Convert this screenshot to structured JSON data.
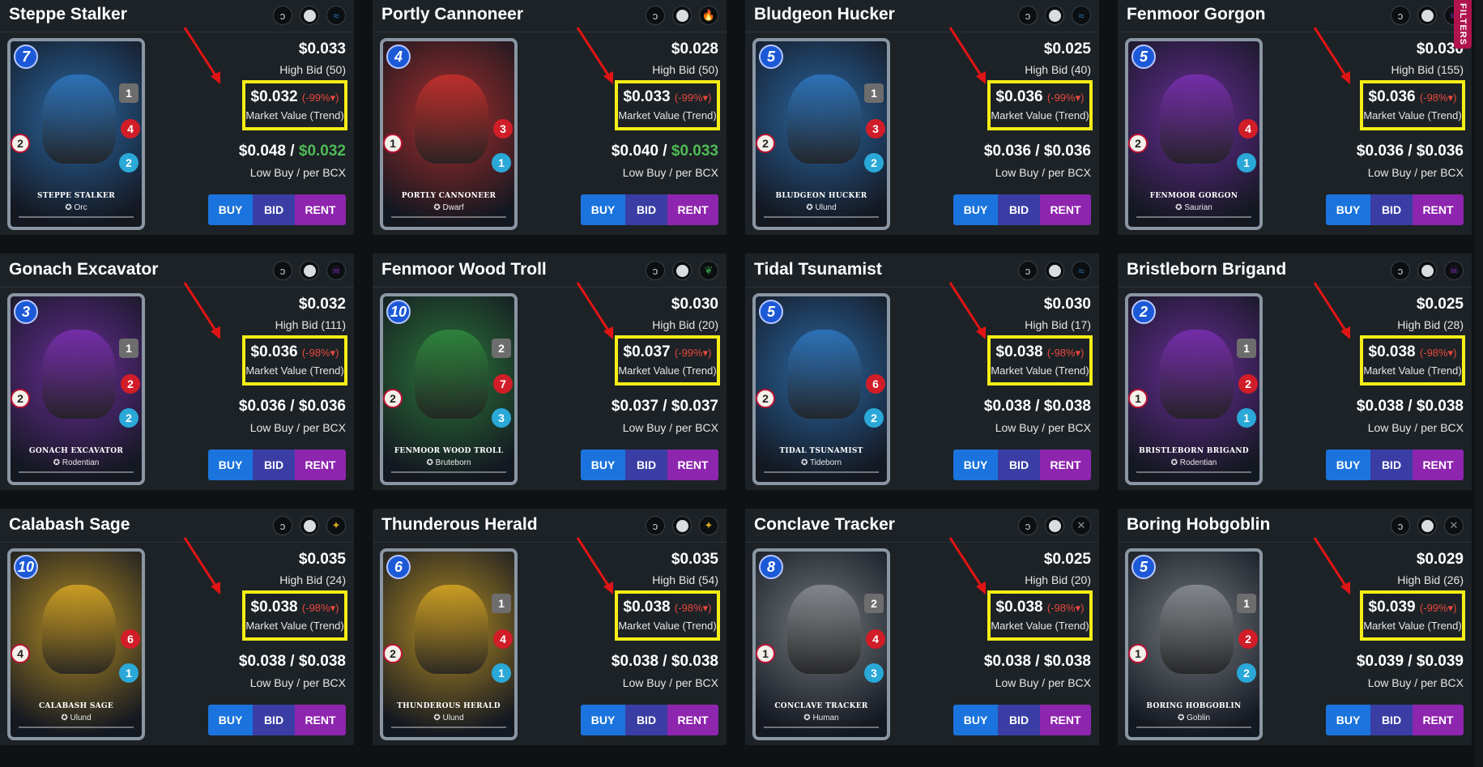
{
  "filters_label": "FILTERS",
  "buttons": {
    "buy": "BUY",
    "bid": "BID",
    "rent": "RENT"
  },
  "market_value_label": "Market Value (Trend)",
  "low_buy_label": "Low Buy / per BCX",
  "cards": [
    {
      "name": "Steppe Stalker",
      "card_name": "STEPPE STALKER",
      "race": "Orc",
      "mana": "7",
      "atk": "2",
      "armor": "1",
      "hp": "4",
      "spd": "2",
      "price": "$0.033",
      "high_bid": "High Bid (50)",
      "mv": "$0.032",
      "trend": "(-99%",
      "low_a": "$0.048",
      "low_b": "$0.032",
      "low_b_green": true,
      "element": "water",
      "color": "#2e78c2"
    },
    {
      "name": "Portly Cannoneer",
      "card_name": "PORTLY CANNONEER",
      "race": "Dwarf",
      "mana": "4",
      "atk": "1",
      "armor": "",
      "hp": "3",
      "spd": "1",
      "price": "$0.028",
      "high_bid": "High Bid (50)",
      "mv": "$0.033",
      "trend": "(-99%",
      "low_a": "$0.040",
      "low_b": "$0.033",
      "low_b_green": true,
      "element": "fire",
      "color": "#c9302c"
    },
    {
      "name": "Bludgeon Hucker",
      "card_name": "BLUDGEON HUCKER",
      "race": "Ulund",
      "mana": "5",
      "atk": "2",
      "armor": "1",
      "hp": "3",
      "spd": "2",
      "price": "$0.025",
      "high_bid": "High Bid (40)",
      "mv": "$0.036",
      "trend": "(-99%",
      "low_a": "$0.036",
      "low_b": "$0.036",
      "low_b_green": false,
      "element": "water",
      "color": "#2e78c2"
    },
    {
      "name": "Fenmoor Gorgon",
      "card_name": "FENMOOR GORGON",
      "race": "Saurian",
      "mana": "5",
      "atk": "2",
      "armor": "",
      "hp": "4",
      "spd": "1",
      "price": "$0.030",
      "high_bid": "High Bid (155)",
      "mv": "$0.036",
      "trend": "(-98%",
      "low_a": "$0.036",
      "low_b": "$0.036",
      "low_b_green": false,
      "element": "death",
      "color": "#7b2fb3"
    },
    {
      "name": "Gonach Excavator",
      "card_name": "GONACH EXCAVATOR",
      "race": "Rodentian",
      "mana": "3",
      "atk": "2",
      "armor": "1",
      "hp": "2",
      "spd": "2",
      "price": "$0.032",
      "high_bid": "High Bid (111)",
      "mv": "$0.036",
      "trend": "(-98%",
      "low_a": "$0.036",
      "low_b": "$0.036",
      "low_b_green": false,
      "element": "death",
      "color": "#7b2fb3"
    },
    {
      "name": "Fenmoor Wood Troll",
      "card_name": "FENMOOR WOOD TROLL",
      "race": "Bruteborn",
      "mana": "10",
      "atk": "2",
      "armor": "2",
      "hp": "7",
      "spd": "3",
      "price": "$0.030",
      "high_bid": "High Bid (20)",
      "mv": "$0.037",
      "trend": "(-99%",
      "low_a": "$0.037",
      "low_b": "$0.037",
      "low_b_green": false,
      "element": "earth",
      "color": "#2f8a3e"
    },
    {
      "name": "Tidal Tsunamist",
      "card_name": "TIDAL TSUNAMIST",
      "race": "Tideborn",
      "mana": "5",
      "atk": "2",
      "armor": "",
      "hp": "6",
      "spd": "2",
      "price": "$0.030",
      "high_bid": "High Bid (17)",
      "mv": "$0.038",
      "trend": "(-98%",
      "low_a": "$0.038",
      "low_b": "$0.038",
      "low_b_green": false,
      "element": "water",
      "color": "#2e78c2"
    },
    {
      "name": "Bristleborn Brigand",
      "card_name": "BRISTLEBORN BRIGAND",
      "race": "Rodentian",
      "mana": "2",
      "atk": "1",
      "armor": "1",
      "hp": "2",
      "spd": "1",
      "price": "$0.025",
      "high_bid": "High Bid (28)",
      "mv": "$0.038",
      "trend": "(-98%",
      "low_a": "$0.038",
      "low_b": "$0.038",
      "low_b_green": false,
      "element": "death",
      "color": "#7b2fb3"
    },
    {
      "name": "Calabash Sage",
      "card_name": "CALABASH SAGE",
      "race": "Ulund",
      "mana": "10",
      "atk": "4",
      "armor": "",
      "hp": "6",
      "spd": "1",
      "price": "$0.035",
      "high_bid": "High Bid (24)",
      "mv": "$0.038",
      "trend": "(-98%",
      "low_a": "$0.038",
      "low_b": "$0.038",
      "low_b_green": false,
      "element": "life",
      "color": "#d8a623"
    },
    {
      "name": "Thunderous Herald",
      "card_name": "THUNDEROUS HERALD",
      "race": "Ulund",
      "mana": "6",
      "atk": "2",
      "armor": "1",
      "hp": "4",
      "spd": "1",
      "price": "$0.035",
      "high_bid": "High Bid (54)",
      "mv": "$0.038",
      "trend": "(-98%",
      "low_a": "$0.038",
      "low_b": "$0.038",
      "low_b_green": false,
      "element": "life",
      "color": "#d8a623"
    },
    {
      "name": "Conclave Tracker",
      "card_name": "CONCLAVE TRACKER",
      "race": "Human",
      "mana": "8",
      "atk": "1",
      "armor": "2",
      "hp": "4",
      "spd": "3",
      "price": "$0.025",
      "high_bid": "High Bid (20)",
      "mv": "$0.038",
      "trend": "(-98%",
      "low_a": "$0.038",
      "low_b": "$0.038",
      "low_b_green": false,
      "element": "neutral",
      "color": "#8a8f94"
    },
    {
      "name": "Boring Hobgoblin",
      "card_name": "BORING HOBGOBLIN",
      "race": "Goblin",
      "mana": "5",
      "atk": "1",
      "armor": "1",
      "hp": "2",
      "spd": "2",
      "price": "$0.029",
      "high_bid": "High Bid (26)",
      "mv": "$0.039",
      "trend": "(-99%",
      "low_a": "$0.039",
      "low_b": "$0.039",
      "low_b_green": false,
      "element": "neutral",
      "color": "#8a8f94"
    }
  ]
}
